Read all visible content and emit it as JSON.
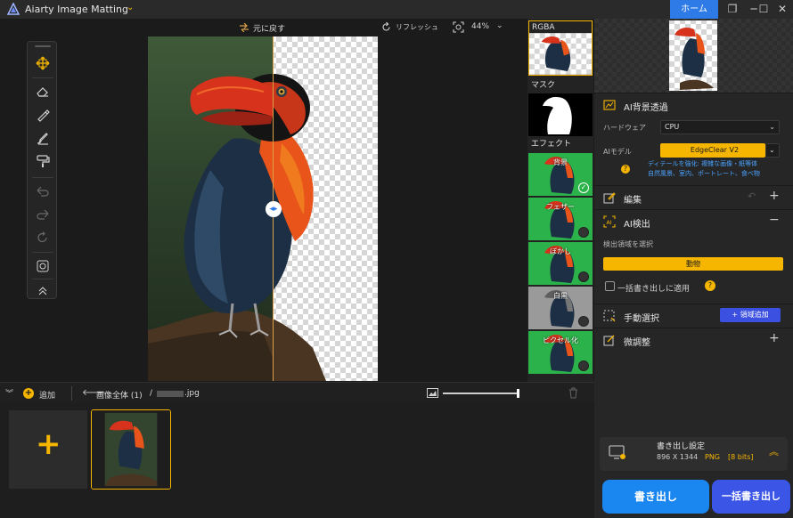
{
  "app": {
    "title": "Aiarty Image Matting",
    "home_label": "ホーム",
    "window_buttons": [
      "restore-icon",
      "minimize-icon",
      "maximize-icon",
      "close-icon"
    ]
  },
  "toolbar": {
    "undo_label": "元に戻す",
    "refresh_label": "リフレッシュ",
    "zoom_label": "44%"
  },
  "effects": {
    "rgba_label": "RGBA",
    "mask_label": "マスク",
    "effects_label": "エフェクト",
    "items": [
      {
        "name": "背景",
        "selected": true
      },
      {
        "name": "フェザー",
        "selected": false
      },
      {
        "name": "ぼかし",
        "selected": false
      },
      {
        "name": "白黒",
        "selected": false
      },
      {
        "name": "ピクセル化",
        "selected": false
      }
    ]
  },
  "panel": {
    "ai_matting_title": "AI背景透過",
    "hardware_label": "ハードウェア",
    "hardware_value": "CPU",
    "model_label": "AIモデル",
    "model_value": "EdgeClear  V2",
    "model_desc_1": "ディテールを強化: 複雑な画像・紙等体",
    "model_desc_2": "自然風景、室内、ポートレート、食べ物",
    "edit_title": "編集",
    "detect_title": "AI検出",
    "detect_area_label": "検出領域を選択",
    "detect_value": "動物",
    "batch_apply_label": "一括書き出しに適用",
    "manual_title": "手動選択",
    "add_area_label": "+ 領域追加",
    "fine_tune_title": "微調整",
    "export_settings_title": "書き出し設定",
    "export_size": "896 X 1344",
    "export_format": "PNG",
    "export_bits": "[8 bits]",
    "export_button": "書き出し",
    "batch_export_button": "一括書き出し"
  },
  "bottom": {
    "add_label": "追加",
    "breadcrumb_label": "画像全体 (1)",
    "file_ext": ".jpg"
  },
  "colors": {
    "accent_yellow": "#f6b600",
    "accent_blue": "#2e7be8",
    "export_blue": "#1a86f0",
    "batch_blue": "#3b55e6"
  }
}
